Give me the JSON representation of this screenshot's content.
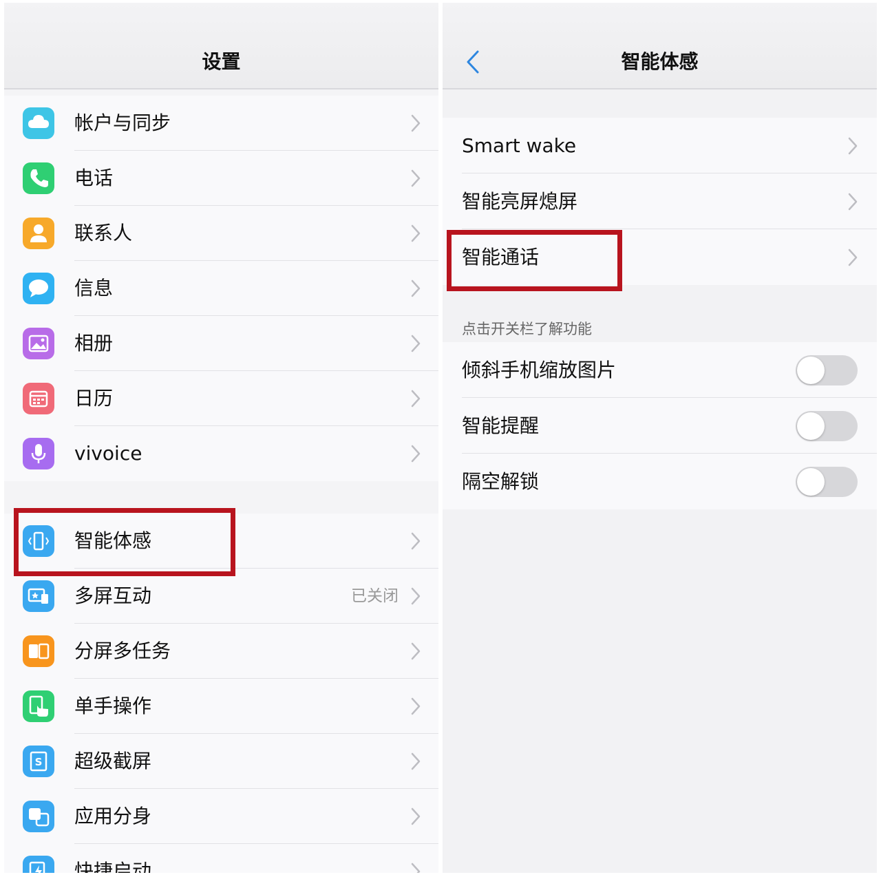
{
  "left_panel": {
    "title": "设置",
    "group1": [
      {
        "label": "帐户与同步",
        "icon": "cloud-icon",
        "color": "#3ec5e6"
      },
      {
        "label": "电话",
        "icon": "phone-icon",
        "color": "#2fcf73"
      },
      {
        "label": "联系人",
        "icon": "contact-icon",
        "color": "#f7a92a"
      },
      {
        "label": "信息",
        "icon": "message-icon",
        "color": "#2fb2f2"
      },
      {
        "label": "相册",
        "icon": "photo-icon",
        "color": "#b86ce8"
      },
      {
        "label": "日历",
        "icon": "calendar-icon",
        "color": "#f06a78"
      },
      {
        "label": "vivoice",
        "icon": "microphone-icon",
        "color": "#a76cf0"
      }
    ],
    "group2": [
      {
        "label": "智能体感",
        "icon": "smart-motion-icon",
        "color": "#3aa8f0"
      },
      {
        "label": "多屏互动",
        "icon": "multi-screen-icon",
        "color": "#3aa8f0",
        "status": "已关闭"
      },
      {
        "label": "分屏多任务",
        "icon": "split-screen-icon",
        "color": "#f8951d"
      },
      {
        "label": "单手操作",
        "icon": "one-hand-icon",
        "color": "#2fcf73"
      },
      {
        "label": "超级截屏",
        "icon": "screenshot-icon",
        "color": "#3aa8f0"
      },
      {
        "label": "应用分身",
        "icon": "app-clone-icon",
        "color": "#3aa8f0"
      },
      {
        "label": "快捷启动",
        "icon": "quick-launch-icon",
        "color": "#3aa8f0"
      }
    ]
  },
  "right_panel": {
    "title": "智能体感",
    "group1": [
      {
        "label": "Smart wake"
      },
      {
        "label": "智能亮屏熄屏"
      },
      {
        "label": "智能通话"
      }
    ],
    "section_title": "点击开关栏了解功能",
    "group2": [
      {
        "label": "倾斜手机缩放图片",
        "on": false
      },
      {
        "label": "智能提醒",
        "on": false
      },
      {
        "label": "隔空解锁",
        "on": false
      }
    ]
  },
  "colors": {
    "highlight": "#b8141e",
    "accent": "#2d86e0"
  }
}
